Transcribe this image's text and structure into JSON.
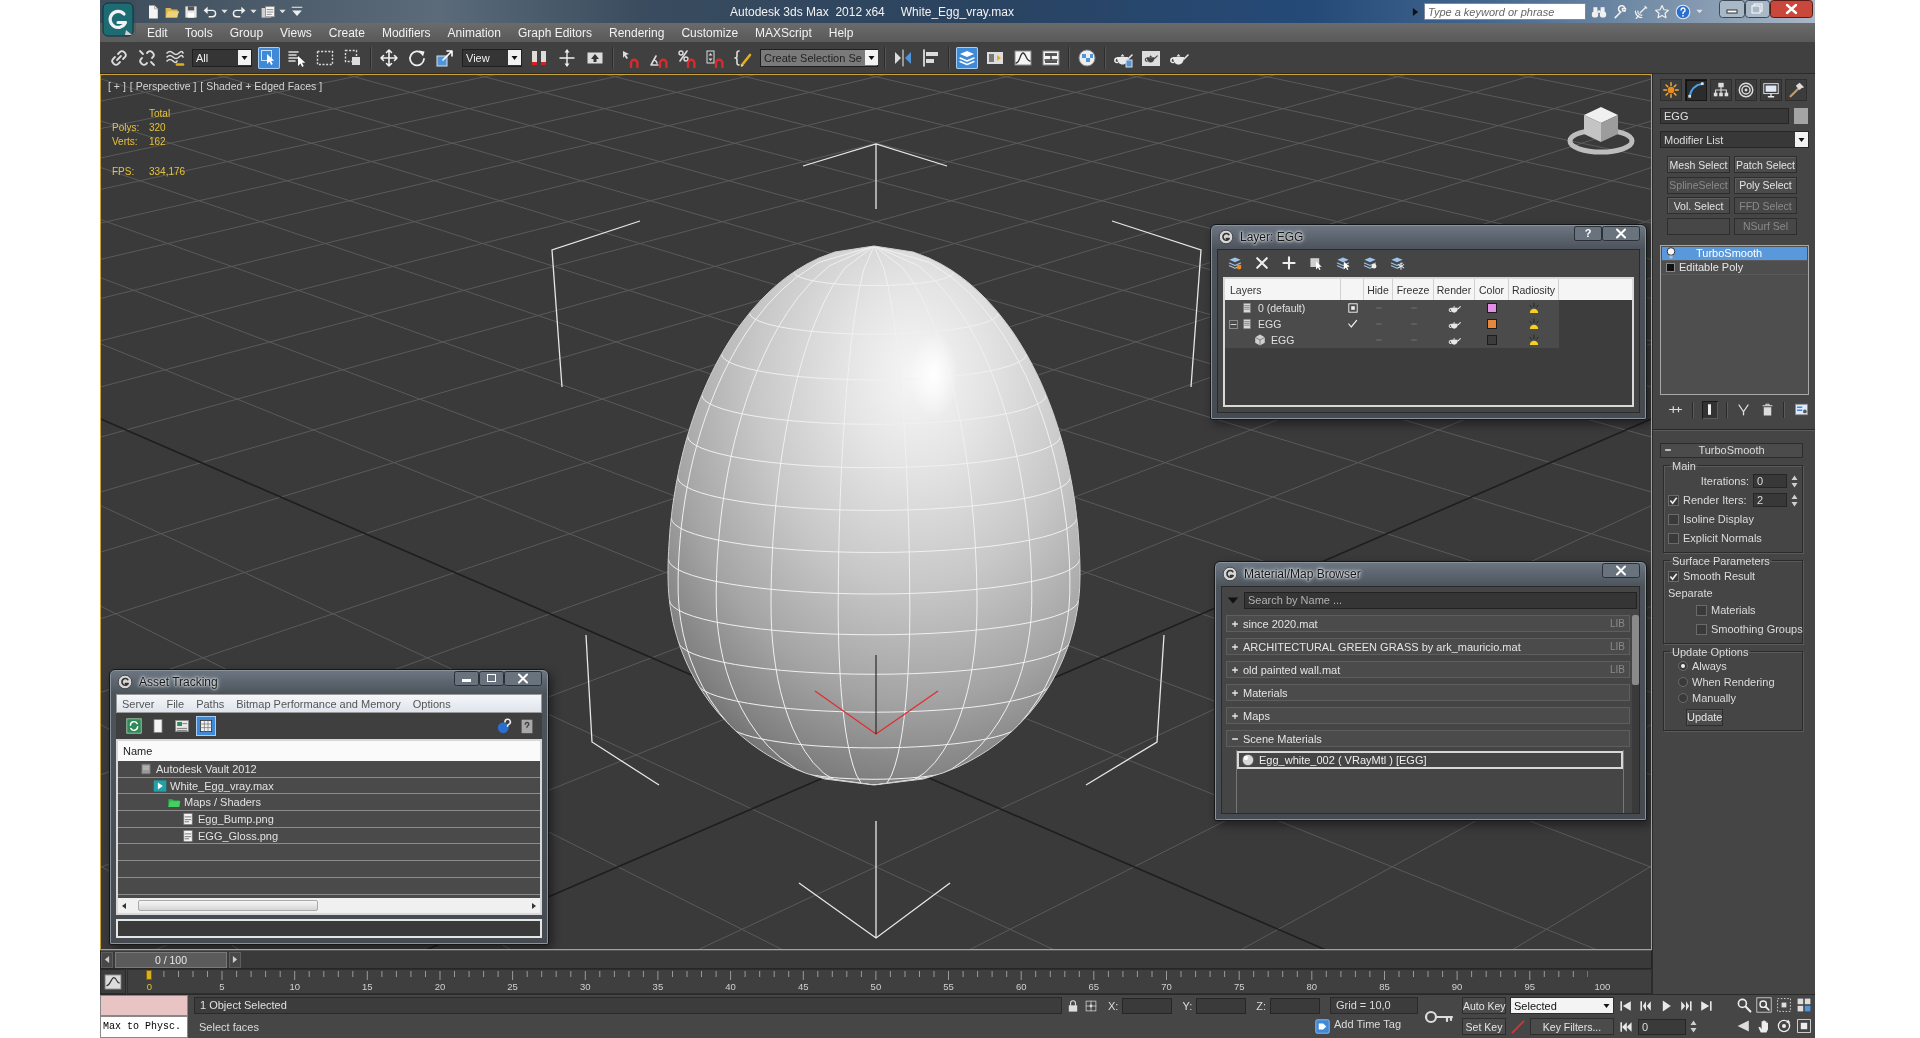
{
  "title_bar": {
    "app_title": "Autodesk 3ds Max  2012 x64",
    "file_name": "White_Egg_vray.max",
    "search": {
      "placeholder": "Type a keyword or phrase"
    }
  },
  "menu": [
    "Edit",
    "Tools",
    "Group",
    "Views",
    "Create",
    "Modifiers",
    "Animation",
    "Graph Editors",
    "Rendering",
    "Customize",
    "MAXScript",
    "Help"
  ],
  "toolbar": {
    "dropdowns": [
      "All",
      "View",
      "Create Selection Se"
    ],
    "buttons": [
      {
        "selected": false
      },
      {
        "selected": false
      },
      {
        "selected": false
      },
      {
        "selected": true
      },
      {
        "selected": false
      },
      {
        "selected": false
      },
      {
        "selected": false
      },
      {
        "selected": false
      },
      {
        "selected": false
      },
      {
        "selected": false
      },
      {
        "selected": false
      },
      {
        "selected": false
      },
      {
        "selected": false
      },
      {
        "selected": false
      },
      {
        "selected": false
      },
      {
        "selected": false
      },
      {
        "selected": false
      },
      {
        "selected": false
      },
      {
        "selected": false
      },
      {
        "selected": false
      },
      {
        "selected": true
      },
      {
        "selected": false
      },
      {
        "selected": false
      },
      {
        "selected": false
      },
      {
        "selected": false
      },
      {
        "selected": false
      },
      {
        "selected": false
      },
      {
        "selected": false
      }
    ]
  },
  "viewport": {
    "labels": [
      "[ + ]",
      "[ Perspective ]",
      "[ Shaded + Edged Faces ]"
    ],
    "stats": {
      "header": "Total",
      "rows": [
        {
          "label": "Polys:",
          "value": "320"
        },
        {
          "label": "Verts:",
          "value": "162"
        }
      ],
      "fps": {
        "label": "FPS:",
        "value": "334,176"
      }
    }
  },
  "layer_dialog": {
    "title": "Layer: EGG",
    "help_button": "?",
    "columns": [
      "Layers",
      "Hide",
      "Freeze",
      "Render",
      "Color",
      "Radiosity"
    ],
    "layers": [
      {
        "name": "0 (default)",
        "kind": "layer",
        "current": false,
        "color": "#e68ee6"
      },
      {
        "name": "EGG",
        "kind": "layer",
        "current": true,
        "expanded": true,
        "color": "#e5883e",
        "children": [
          {
            "name": "EGG",
            "kind": "object",
            "color": "#3c3c3c"
          }
        ]
      }
    ]
  },
  "material_browser": {
    "title": "Material/Map Browser",
    "search": {
      "placeholder": "Search by Name ..."
    },
    "groups": [
      {
        "label": "since 2020.mat",
        "expanded": false,
        "tag": "LIB"
      },
      {
        "label": "ARCHITECTURAL GREEN GRASS by ark_mauricio.mat",
        "expanded": false,
        "tag": "LIB"
      },
      {
        "label": "old painted wall.mat",
        "expanded": false,
        "tag": "LIB"
      },
      {
        "label": "Materials",
        "expanded": false
      },
      {
        "label": "Maps",
        "expanded": false
      },
      {
        "label": "Scene Materials",
        "expanded": true,
        "items": [
          {
            "label": "Egg_white_002 ( VRayMtl ) [EGG]",
            "selected": true
          }
        ]
      }
    ]
  },
  "asset_tracking": {
    "title": "Asset Tracking",
    "menu": [
      "Server",
      "File",
      "Paths",
      "Bitmap Performance and Memory",
      "Options"
    ],
    "tools": [
      {
        "selected": false
      },
      {
        "selected": false
      },
      {
        "selected": false
      },
      {
        "selected": true
      }
    ],
    "column": "Name",
    "tree": [
      {
        "label": "Autodesk Vault 2012",
        "kind": "vault",
        "children": [
          {
            "label": "White_Egg_vray.max",
            "kind": "scene",
            "children": [
              {
                "label": "Maps / Shaders",
                "kind": "folder",
                "children": [
                  {
                    "label": "Egg_Bump.png",
                    "kind": "bitmap"
                  },
                  {
                    "label": "EGG_Gloss.png",
                    "kind": "bitmap"
                  }
                ]
              }
            ]
          }
        ]
      }
    ]
  },
  "command_panel": {
    "tabs": [
      {
        "selected": false
      },
      {
        "selected": true
      },
      {
        "selected": false
      },
      {
        "selected": false
      },
      {
        "selected": false
      },
      {
        "selected": false
      }
    ],
    "object_name": "EGG",
    "modifier_list": "Modifier List",
    "modifier_buttons": [
      {
        "label": "Mesh Select",
        "disabled": false
      },
      {
        "label": "Patch Select",
        "disabled": false
      },
      {
        "label": "SplineSelect",
        "disabled": true
      },
      {
        "label": "Poly Select",
        "disabled": false
      },
      {
        "label": "Vol. Select",
        "disabled": false
      },
      {
        "label": "FFD Select",
        "disabled": true
      },
      {
        "disabled": true
      },
      {
        "label": "NSurf Sel",
        "disabled": true
      }
    ],
    "stack": [
      {
        "label": "TurboSmooth",
        "kind": "modifier",
        "selected": true
      },
      {
        "label": "Editable Poly",
        "kind": "base",
        "selected": false
      }
    ],
    "stack_tools": [
      {
        "selected": false
      },
      {
        "selected": true
      },
      {
        "selected": false
      },
      {
        "selected": false
      },
      {
        "selected": false
      }
    ],
    "rollout": {
      "title": "TurboSmooth",
      "expanded": true,
      "main": {
        "title": "Main",
        "iterations": {
          "label": "Iterations:",
          "value": "0"
        },
        "render_iters": {
          "label": "Render Iters:",
          "checked": true,
          "value": "2"
        },
        "options": [
          {
            "label": "Isoline Display",
            "checked": false
          },
          {
            "label": "Explicit Normals",
            "checked": false
          }
        ]
      },
      "surface": {
        "title": "Surface Parameters",
        "smooth_result": {
          "label": "Smooth Result",
          "checked": true
        },
        "separate": "Separate",
        "options": [
          {
            "label": "Materials",
            "checked": false
          },
          {
            "label": "Smoothing Groups",
            "checked": false
          }
        ]
      },
      "update": {
        "title": "Update Options",
        "modes": [
          {
            "label": "Always",
            "selected": true
          },
          {
            "label": "When Rendering",
            "selected": false
          },
          {
            "label": "Manually",
            "selected": false
          }
        ],
        "button": "Update"
      }
    }
  },
  "time_slider": {
    "frame": "0 / 100"
  },
  "track_bar": {
    "labels": [
      {
        "label": "0",
        "current": true
      },
      {
        "label": "5",
        "current": false
      },
      {
        "label": "10",
        "current": false
      },
      {
        "label": "15",
        "current": false
      },
      {
        "label": "20",
        "current": false
      },
      {
        "label": "25",
        "current": false
      },
      {
        "label": "30",
        "current": false
      },
      {
        "label": "35",
        "current": false
      },
      {
        "label": "40",
        "current": false
      },
      {
        "label": "45",
        "current": false
      },
      {
        "label": "50",
        "current": false
      },
      {
        "label": "55",
        "current": false
      },
      {
        "label": "60",
        "current": false
      },
      {
        "label": "65",
        "current": false
      },
      {
        "label": "70",
        "current": false
      },
      {
        "label": "75",
        "current": false
      },
      {
        "label": "80",
        "current": false
      },
      {
        "label": "85",
        "current": false
      },
      {
        "label": "90",
        "current": false
      },
      {
        "label": "95",
        "current": false
      },
      {
        "label": "100",
        "current": false
      }
    ]
  },
  "status_bar": {
    "listener": "Max to Physc.",
    "selection_info": "1 Object Selected",
    "prompt": "Select faces",
    "coords": [
      "X:",
      "Y:",
      "Z:"
    ],
    "grid": "Grid = 10,0",
    "time_tag": "Add Time Tag",
    "auto_key": "Auto Key",
    "key_set": "Selected",
    "set_key": "Set Key",
    "key_filters": "Key Filters...",
    "frame": "0"
  }
}
